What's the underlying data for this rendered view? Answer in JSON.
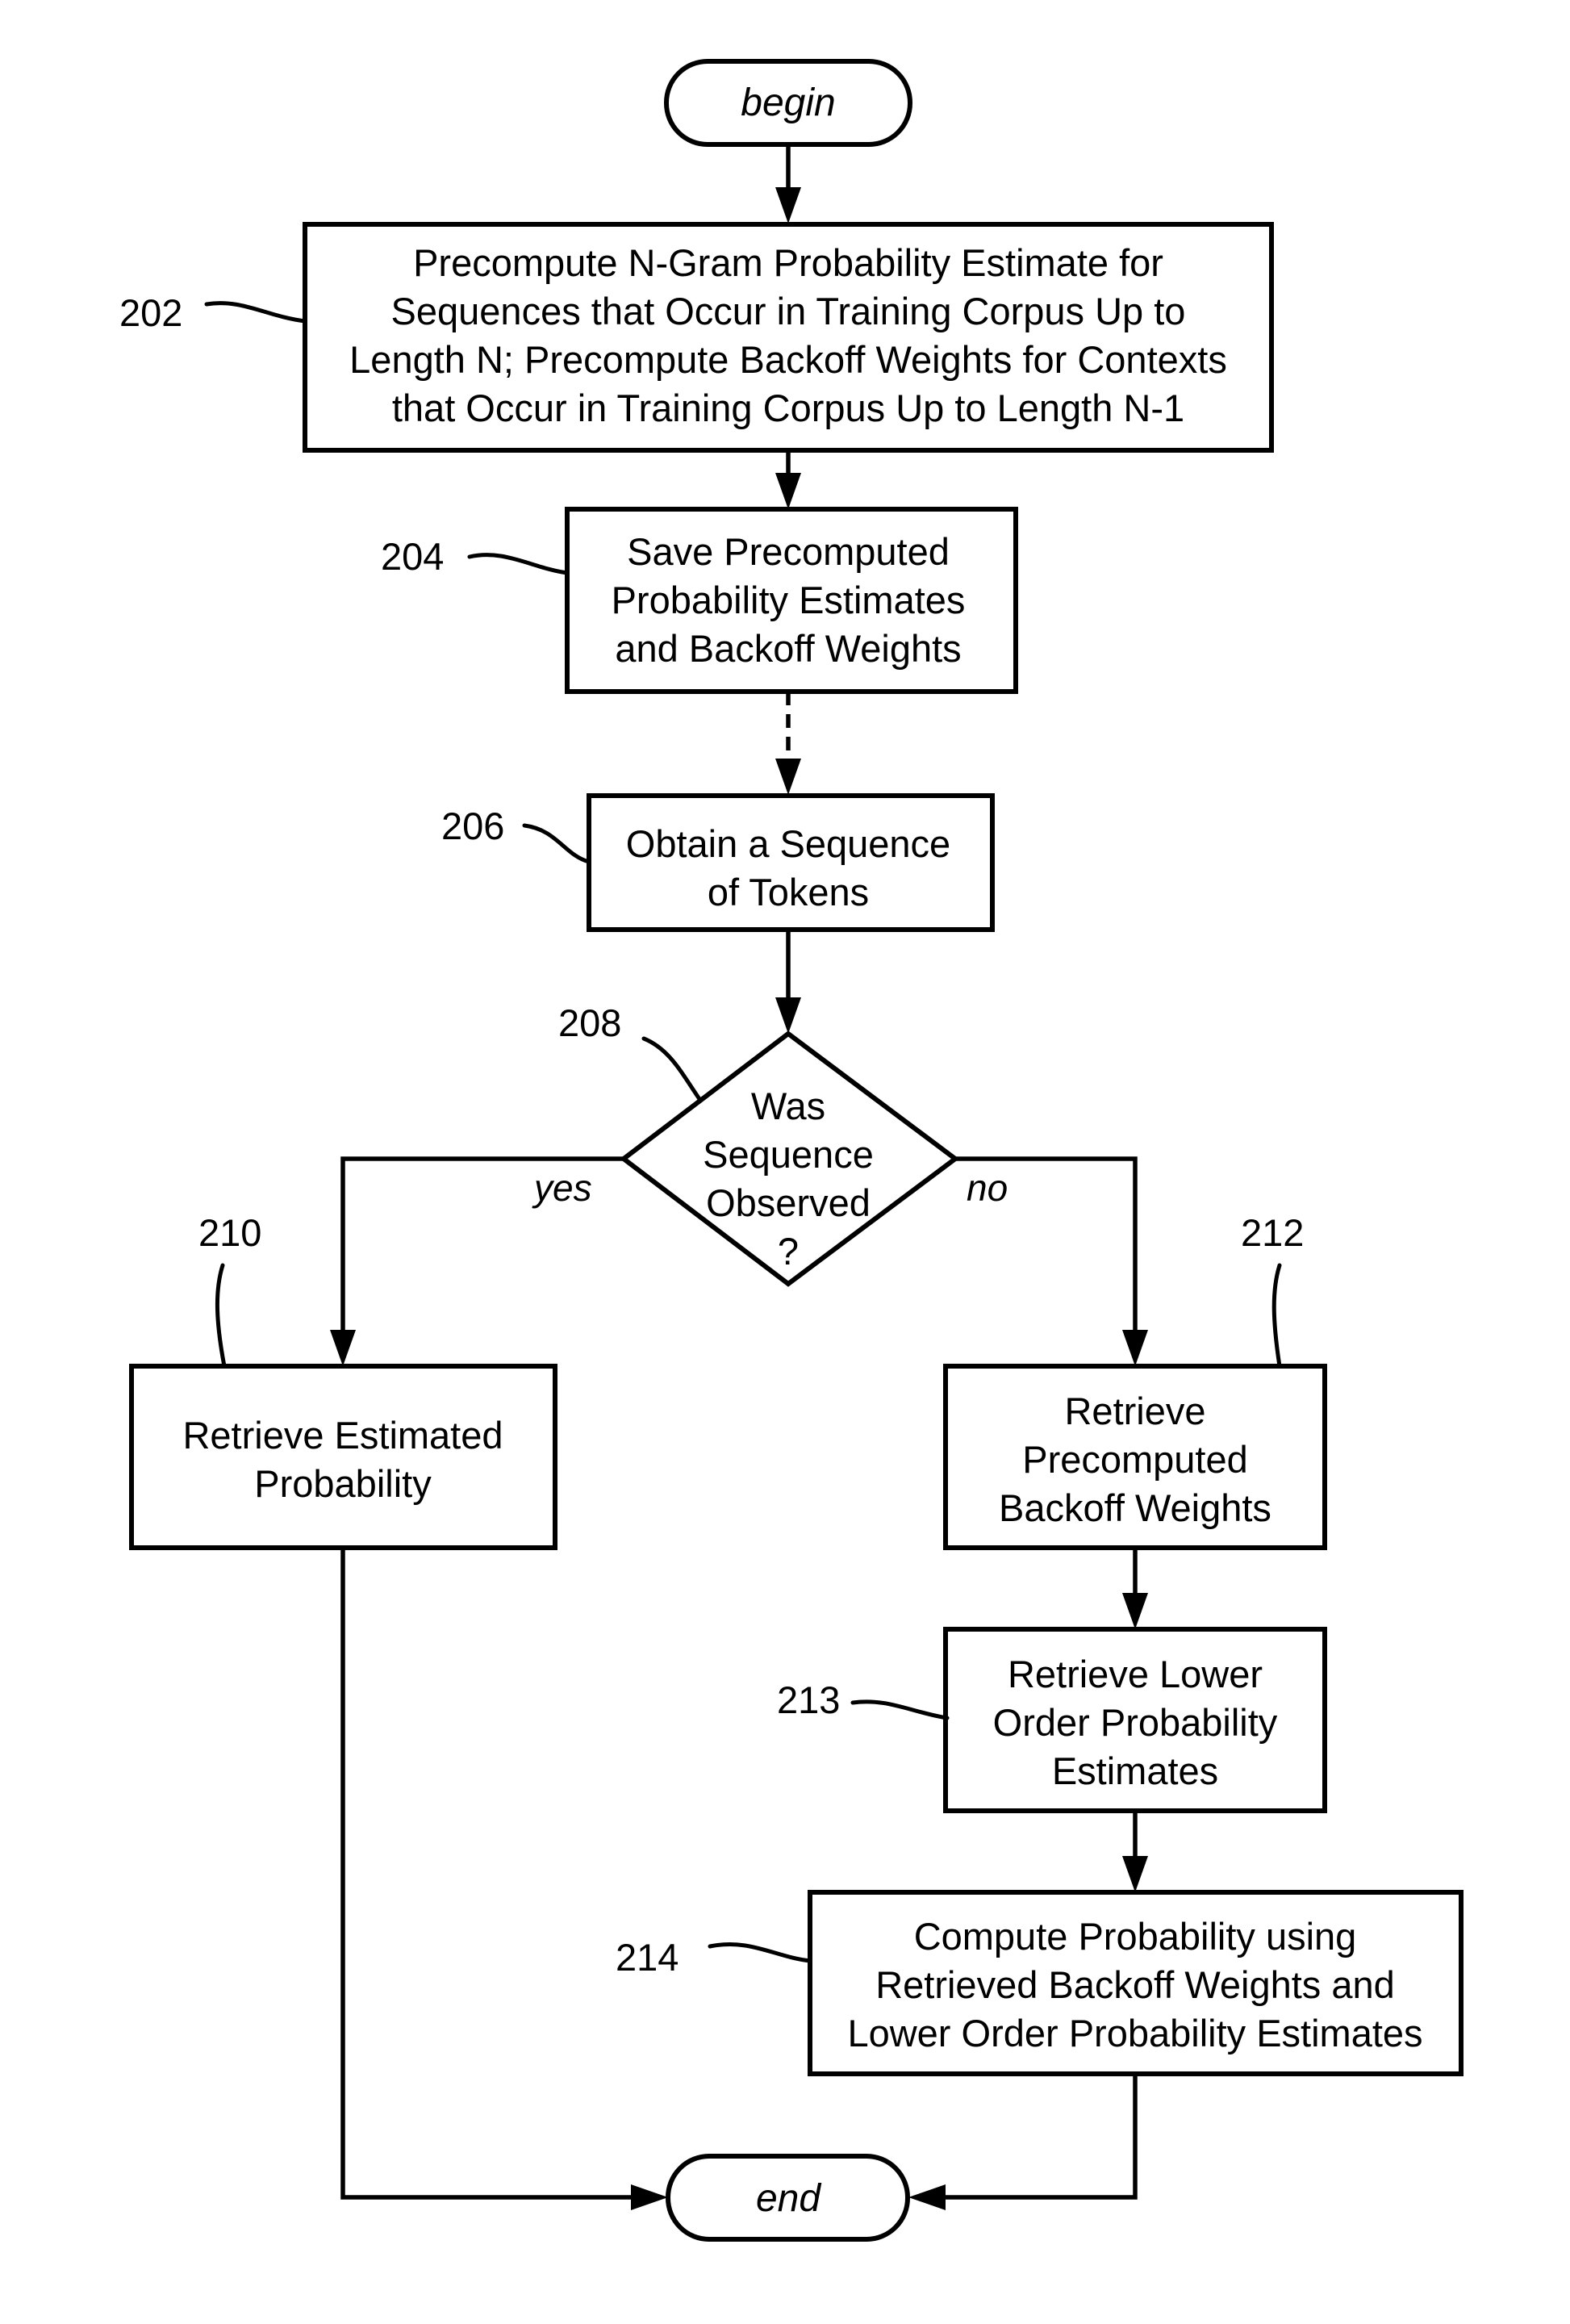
{
  "terminals": {
    "begin": "begin",
    "end": "end"
  },
  "steps": {
    "s202": {
      "ref": "202",
      "lines": [
        "Precompute N-Gram Probability Estimate for",
        "Sequences that Occur in Training Corpus Up to",
        "Length N; Precompute Backoff Weights for Contexts",
        "that Occur in Training Corpus Up to Length N-1"
      ]
    },
    "s204": {
      "ref": "204",
      "lines": [
        "Save Precomputed",
        "Probability Estimates",
        "and  Backoff Weights"
      ]
    },
    "s206": {
      "ref": "206",
      "lines": [
        "Obtain a Sequence",
        "of Tokens"
      ]
    },
    "s208": {
      "ref": "208",
      "lines": [
        "Was",
        "Sequence",
        "Observed",
        "?"
      ]
    },
    "s210": {
      "ref": "210",
      "lines": [
        "Retrieve Estimated",
        "Probability"
      ]
    },
    "s212": {
      "ref": "212",
      "lines": [
        "Retrieve",
        "Precomputed",
        "Backoff Weights"
      ]
    },
    "s213": {
      "ref": "213",
      "lines": [
        "Retrieve Lower",
        "Order Probability",
        "Estimates"
      ]
    },
    "s214": {
      "ref": "214",
      "lines": [
        "Compute Probability using",
        "Retrieved Backoff Weights and",
        "Lower Order Probability Estimates"
      ]
    }
  },
  "branches": {
    "yes": "yes",
    "no": "no"
  }
}
